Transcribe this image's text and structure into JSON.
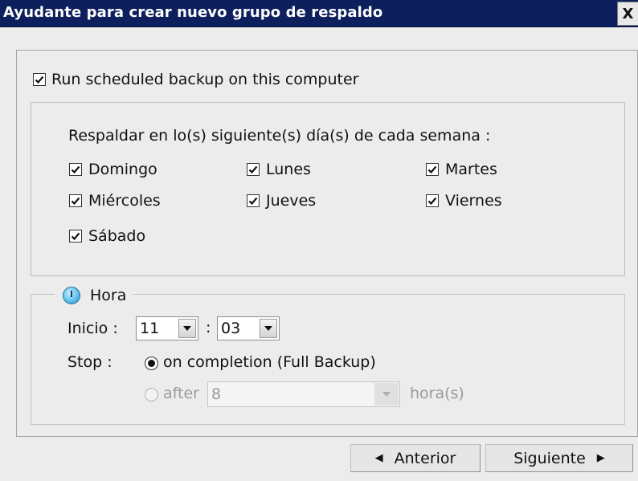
{
  "window": {
    "title": "Ayudante para crear nuevo grupo de respaldo",
    "close_label": "X"
  },
  "schedule": {
    "run_label": "Run scheduled backup on this computer",
    "run_checked": true
  },
  "days": {
    "heading": "Respaldar en lo(s) siguiente(s) día(s) de cada semana :",
    "items": [
      {
        "label": "Domingo",
        "checked": true
      },
      {
        "label": "Lunes",
        "checked": true
      },
      {
        "label": "Martes",
        "checked": true
      },
      {
        "label": "Miércoles",
        "checked": true
      },
      {
        "label": "Jueves",
        "checked": true
      },
      {
        "label": "Viernes",
        "checked": true
      },
      {
        "label": "Sábado",
        "checked": true
      }
    ]
  },
  "time": {
    "legend": "Hora",
    "start_label": "Inicio :",
    "hour": "11",
    "separator": ":",
    "minute": "03",
    "stop_label": "Stop :",
    "option_completion": "on completion (Full Backup)",
    "option_after": "after",
    "after_value": "8",
    "unit": "hora(s)",
    "selected": "on completion (Full Backup)"
  },
  "buttons": {
    "previous": "Anterior",
    "next": "Siguiente"
  }
}
